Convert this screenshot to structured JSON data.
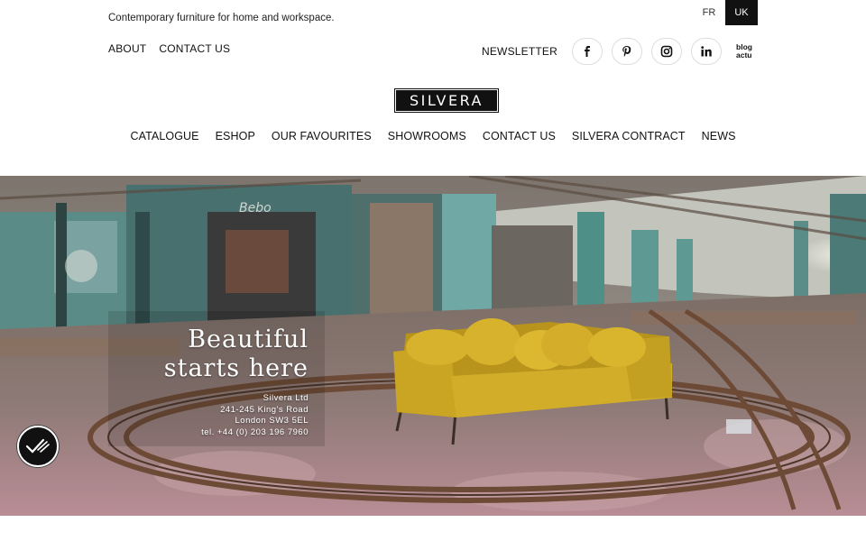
{
  "header": {
    "tagline": "Contemporary furniture for home and workspace.",
    "languages": [
      "FR",
      "UK"
    ],
    "active_language": "UK",
    "top_links": [
      "ABOUT",
      "CONTACT US"
    ],
    "newsletter": "NEWSLETTER",
    "social_icons": [
      "facebook-icon",
      "pinterest-icon",
      "instagram-icon",
      "linkedin-icon"
    ],
    "blog_label_line1": "blog",
    "blog_label_line2": "actu"
  },
  "logo": {
    "text": "SILVERA"
  },
  "main_nav": [
    "CATALOGUE",
    "ESHOP",
    "OUR FAVOURITES",
    "SHOWROOMS",
    "CONTACT US",
    "SILVERA CONTRACT",
    "NEWS"
  ],
  "hero": {
    "title_line1": "Beautiful",
    "title_line2": "starts here",
    "address": [
      "Silvera Ltd",
      "241-245 King's Road",
      "London SW3 5EL",
      "tel. +44 (0) 203 196 7960"
    ],
    "sofa_color": "#c9a523"
  },
  "badge": {
    "icon": "checkmark-icon"
  }
}
